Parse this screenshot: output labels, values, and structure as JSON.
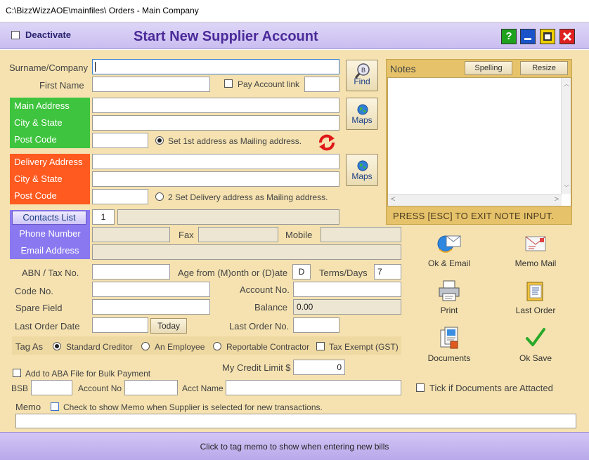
{
  "window": {
    "title": "C:\\BizzWizzAOE\\mainfiles\\ Orders - Main Company"
  },
  "header": {
    "deactivate_label": "Deactivate",
    "page_title": "Start New Supplier Account",
    "help_glyph": "?"
  },
  "fields": {
    "surname_label": "Surname/Company",
    "first_name_label": "First Name",
    "pay_account_link_label": "Pay Account link",
    "find_label": "Find",
    "main_address_label": "Main Address",
    "city_state_label": "City & State",
    "post_code_label": "Post Code",
    "mailing_1_label": "Set 1st address as Mailing address.",
    "maps_label": "Maps",
    "delivery_address_label": "Delivery Address",
    "mailing_2_label": "2 Set Delivery address as Mailing address.",
    "contacts_list_label": "Contacts List",
    "contact_index_value": "1",
    "phone_label": "Phone Number",
    "fax_label": "Fax",
    "mobile_label": "Mobile",
    "email_label": "Email Address",
    "abn_label": "ABN / Tax No.",
    "age_label": "Age from (M)onth or (D)ate",
    "age_value": "D",
    "terms_label": "Terms/Days",
    "terms_value": "7",
    "code_label": "Code No.",
    "account_no_label": "Account No.",
    "spare_label": "Spare Field",
    "balance_label": "Balance",
    "balance_value": "0.00",
    "last_order_date_label": "Last Order Date",
    "today_label": "Today",
    "last_order_no_label": "Last Order No.",
    "tag_as_label": "Tag As",
    "tag_standard": "Standard Creditor",
    "tag_employee": "An Employee",
    "tag_reportable": "Reportable Contractor",
    "tax_exempt_label": "Tax Exempt (GST)",
    "aba_label": "Add to ABA File for Bulk Payment",
    "credit_limit_label": "My Credit Limit $",
    "credit_limit_value": "0",
    "bsb_label": "BSB",
    "bank_account_label": "Account No",
    "acct_name_label": "Acct Name",
    "docs_attached_label": "Tick if Documents are Attacted",
    "memo_label": "Memo",
    "memo_check_label": "Check to show Memo when Supplier is selected for new transactions."
  },
  "notes": {
    "title": "Notes",
    "spelling_label": "Spelling",
    "resize_label": "Resize",
    "hint": "PRESS [ESC] TO EXIT NOTE INPUT."
  },
  "actions": {
    "ok_email": "Ok & Email",
    "memo_mail": "Memo Mail",
    "print": "Print",
    "last_order": "Last Order",
    "documents": "Documents",
    "ok_save": "Ok Save"
  },
  "footer": {
    "text": "Click to tag memo to show when entering new bills"
  },
  "colors": {
    "green_band": "#3ec43e",
    "orange_band": "#ff5a1f",
    "purple_band": "#8a78f0",
    "body_bg": "#f5e2b0",
    "title_purple": "#4b2a9a"
  },
  "icons": [
    "find-icon",
    "globe-icon",
    "swap-arrows-icon",
    "email-icon",
    "memo-mail-icon",
    "printer-icon",
    "last-order-icon",
    "documents-icon",
    "checkmark-icon",
    "help-icon",
    "minimize-icon",
    "maximize-icon",
    "close-icon"
  ]
}
